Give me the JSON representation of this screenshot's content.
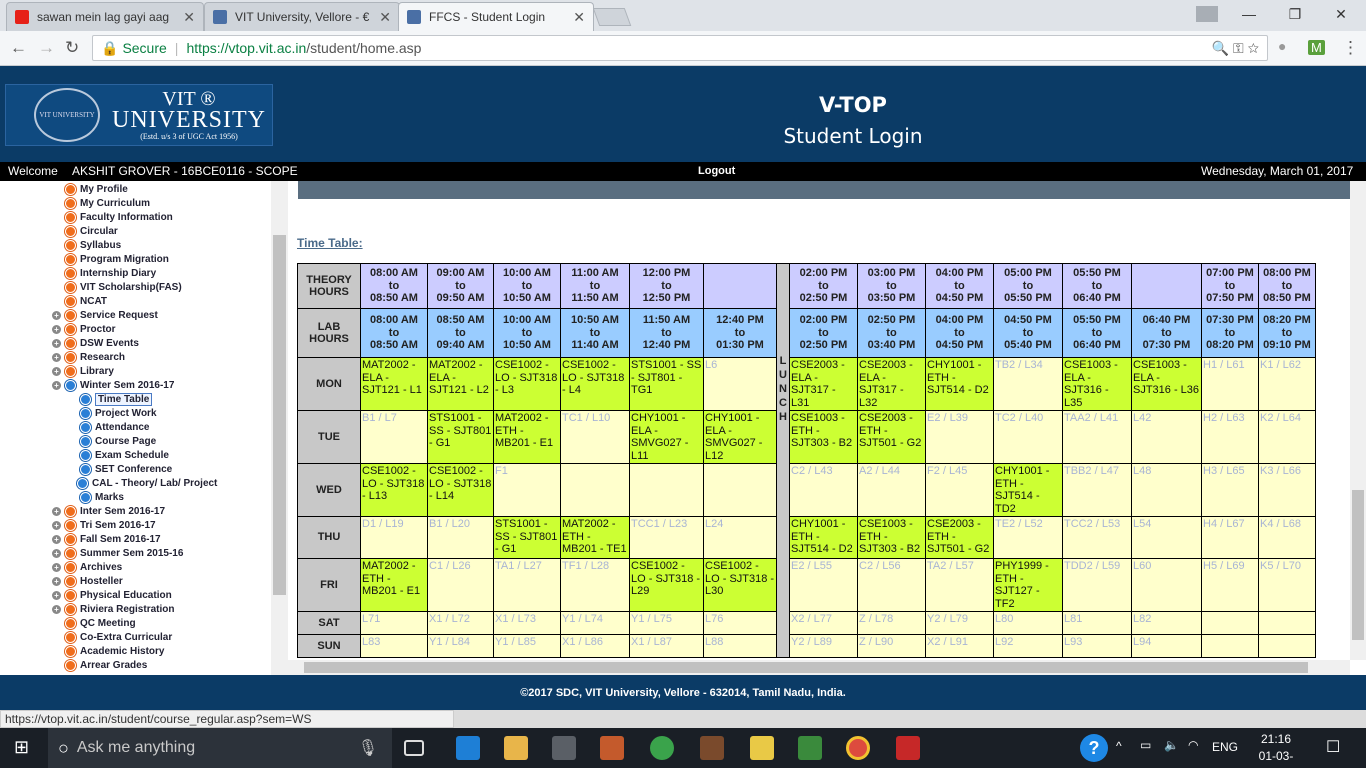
{
  "browser": {
    "tabs": [
      {
        "title": "sawan mein lag gayi aag",
        "icon_color": "#e62117",
        "icon": "youtube-icon"
      },
      {
        "title": "VIT University, Vellore - €",
        "icon_color": "#4a6fa5",
        "icon": "vit-favicon-icon"
      },
      {
        "title": "FFCS - Student Login",
        "icon_color": "#4a6fa5",
        "icon": "vit-favicon-icon"
      }
    ],
    "secure_label": "Secure",
    "url_host": "https://vtop.vit.ac.in",
    "url_path": "/student/home.asp",
    "status_url": "https://vtop.vit.ac.in/student/course_regular.asp?sem=WS"
  },
  "header": {
    "logo_line1": "VIT ®",
    "logo_line2": "UNIVERSITY",
    "logo_line3": "(Estd. u/s 3 of UGC Act 1956)",
    "seal_text": "VIT UNIVERSITY",
    "title1": "V-TOP",
    "title2": "Student Login"
  },
  "welcome": {
    "label": "Welcome",
    "user": "AKSHIT GROVER - 16BCE0116 - SCOPE",
    "logout": "Logout",
    "date": "Wednesday, March 01, 2017"
  },
  "sidebar": {
    "items": [
      {
        "label": "My Profile",
        "type": "or",
        "level": 0
      },
      {
        "label": "My Curriculum",
        "type": "or",
        "level": 0
      },
      {
        "label": "Faculty Information",
        "type": "or",
        "level": 0
      },
      {
        "label": "Circular",
        "type": "or",
        "level": 0
      },
      {
        "label": "Syllabus",
        "type": "or",
        "level": 0
      },
      {
        "label": "Program Migration",
        "type": "or",
        "level": 0
      },
      {
        "label": "Internship Diary",
        "type": "or",
        "level": 0
      },
      {
        "label": "VIT Scholarship(FAS)",
        "type": "or",
        "level": 0
      },
      {
        "label": "NCAT",
        "type": "or",
        "level": 0
      },
      {
        "label": "Service Request",
        "type": "or",
        "level": 0,
        "expand": true
      },
      {
        "label": "Proctor",
        "type": "or",
        "level": 0,
        "expand": true
      },
      {
        "label": "DSW Events",
        "type": "or",
        "level": 0,
        "expand": true
      },
      {
        "label": "Research",
        "type": "or",
        "level": 0,
        "expand": true
      },
      {
        "label": "Library",
        "type": "or",
        "level": 0,
        "expand": true
      },
      {
        "label": "Winter Sem 2016-17",
        "type": "bl",
        "level": 0,
        "expand": true
      },
      {
        "label": "Time Table",
        "type": "bl",
        "level": 1,
        "selected": true
      },
      {
        "label": "Project Work",
        "type": "bl",
        "level": 1
      },
      {
        "label": "Attendance",
        "type": "bl",
        "level": 1
      },
      {
        "label": "Course Page",
        "type": "bl",
        "level": 1
      },
      {
        "label": "Exam Schedule",
        "type": "bl",
        "level": 1
      },
      {
        "label": "SET Conference",
        "type": "bl",
        "level": 1
      },
      {
        "label": "CAL - Theory/ Lab/ Project",
        "type": "bl",
        "level": 2
      },
      {
        "label": "Marks",
        "type": "bl",
        "level": 1
      },
      {
        "label": "Inter Sem 2016-17",
        "type": "or",
        "level": 0,
        "expand": true
      },
      {
        "label": "Tri Sem 2016-17",
        "type": "or",
        "level": 0,
        "expand": true
      },
      {
        "label": "Fall Sem 2016-17",
        "type": "or",
        "level": 0,
        "expand": true
      },
      {
        "label": "Summer Sem 2015-16",
        "type": "or",
        "level": 0,
        "expand": true
      },
      {
        "label": "Archives",
        "type": "or",
        "level": 0,
        "expand": true
      },
      {
        "label": "Hosteller",
        "type": "or",
        "level": 0,
        "expand": true
      },
      {
        "label": "Physical Education",
        "type": "or",
        "level": 0,
        "expand": true
      },
      {
        "label": "Riviera Registration",
        "type": "or",
        "level": 0,
        "expand": true
      },
      {
        "label": "QC Meeting",
        "type": "or",
        "level": 0
      },
      {
        "label": "Co-Extra Curricular",
        "type": "or",
        "level": 0
      },
      {
        "label": "Academic History",
        "type": "or",
        "level": 0
      },
      {
        "label": "Arrear Grades",
        "type": "or",
        "level": 0
      }
    ]
  },
  "timetable": {
    "title": "Time Table:",
    "theory_label": [
      "THEORY",
      "HOURS"
    ],
    "lab_label": [
      "LAB",
      "HOURS"
    ],
    "lunch_letters": [
      "L",
      "U",
      "N",
      "C",
      "H"
    ],
    "theory_hours": [
      "08:00 AM to 08:50 AM",
      "09:00 AM to 09:50 AM",
      "10:00 AM to 10:50 AM",
      "11:00 AM to 11:50 AM",
      "12:00 PM to 12:50 PM",
      "",
      "02:00 PM to 02:50 PM",
      "03:00 PM to 03:50 PM",
      "04:00 PM to 04:50 PM",
      "05:00 PM to 05:50 PM",
      "05:50 PM to 06:40 PM",
      "",
      "07:00 PM to 07:50 PM",
      "08:00 PM to 08:50 PM"
    ],
    "lab_hours": [
      "08:00 AM to 08:50 AM",
      "08:50 AM to 09:40 AM",
      "10:00 AM to 10:50 AM",
      "10:50 AM to 11:40 AM",
      "11:50 AM to 12:40 PM",
      "12:40 PM to 01:30 PM",
      "02:00 PM to 02:50 PM",
      "02:50 PM to 03:40 PM",
      "04:00 PM to 04:50 PM",
      "04:50 PM to 05:40 PM",
      "05:50 PM to 06:40 PM",
      "06:40 PM to 07:30 PM",
      "07:30 PM to 08:20 PM",
      "08:20 PM to 09:10 PM"
    ],
    "days": [
      {
        "name": "MON",
        "cells": [
          [
            "MAT2002 - ELA - SJT121 - L1",
            1
          ],
          [
            "MAT2002 - ELA - SJT121 - L2",
            1
          ],
          [
            "CSE1002 - LO - SJT318 - L3",
            1
          ],
          [
            "CSE1002 - LO - SJT318 - L4",
            1
          ],
          [
            "STS1001 - SS - SJT801 - TG1",
            1
          ],
          [
            "L6",
            0
          ],
          [
            "CSE2003 - ELA - SJT317 - L31",
            1
          ],
          [
            "CSE2003 - ELA - SJT317 - L32",
            1
          ],
          [
            "CHY1001 - ETH - SJT514 - D2",
            1
          ],
          [
            "TB2 / L34",
            0
          ],
          [
            "CSE1003 - ELA - SJT316 - L35",
            1
          ],
          [
            "CSE1003 - ELA - SJT316 - L36",
            1
          ],
          [
            "H1 / L61",
            0
          ],
          [
            "K1 / L62",
            0
          ]
        ]
      },
      {
        "name": "TUE",
        "cells": [
          [
            "B1 / L7",
            0
          ],
          [
            "STS1001 - SS - SJT801 - G1",
            1
          ],
          [
            "MAT2002 - ETH - MB201 - E1",
            1
          ],
          [
            "TC1 / L10",
            0
          ],
          [
            "CHY1001 - ELA - SMVG027 - L11",
            1
          ],
          [
            "CHY1001 - ELA - SMVG027 - L12",
            1
          ],
          [
            "CSE1003 - ETH - SJT303 - B2",
            1
          ],
          [
            "CSE2003 - ETH - SJT501 - G2",
            1
          ],
          [
            "E2 / L39",
            0
          ],
          [
            "TC2 / L40",
            0
          ],
          [
            "TAA2 / L41",
            0
          ],
          [
            "L42",
            0
          ],
          [
            "H2 / L63",
            0
          ],
          [
            "K2 / L64",
            0
          ]
        ]
      },
      {
        "name": "WED",
        "cells": [
          [
            "CSE1002 - LO - SJT318 - L13",
            1
          ],
          [
            "CSE1002 - LO - SJT318 - L14",
            1
          ],
          [
            "F1",
            0
          ],
          [
            "",
            0
          ],
          [
            "",
            0
          ],
          [
            "",
            0
          ],
          [
            "C2 / L43",
            0
          ],
          [
            "A2 / L44",
            0
          ],
          [
            "F2 / L45",
            0
          ],
          [
            "CHY1001 - ETH - SJT514 - TD2",
            1
          ],
          [
            "TBB2 / L47",
            0
          ],
          [
            "L48",
            0
          ],
          [
            "H3 / L65",
            0
          ],
          [
            "K3 / L66",
            0
          ]
        ]
      },
      {
        "name": "THU",
        "cells": [
          [
            "D1 / L19",
            0
          ],
          [
            "B1 / L20",
            0
          ],
          [
            "STS1001 - SS - SJT801 - G1",
            1
          ],
          [
            "MAT2002 - ETH - MB201 - TE1",
            1
          ],
          [
            "TCC1 / L23",
            0
          ],
          [
            "L24",
            0
          ],
          [
            "CHY1001 - ETH - SJT514 - D2",
            1
          ],
          [
            "CSE1003 - ETH - SJT303 - B2",
            1
          ],
          [
            "CSE2003 - ETH - SJT501 - G2",
            1
          ],
          [
            "TE2 / L52",
            0
          ],
          [
            "TCC2 / L53",
            0
          ],
          [
            "L54",
            0
          ],
          [
            "H4 / L67",
            0
          ],
          [
            "K4 / L68",
            0
          ]
        ]
      },
      {
        "name": "FRI",
        "cells": [
          [
            "MAT2002 - ETH - MB201 - E1",
            1
          ],
          [
            "C1 / L26",
            0
          ],
          [
            "TA1 / L27",
            0
          ],
          [
            "TF1 / L28",
            0
          ],
          [
            "CSE1002 - LO - SJT318 - L29",
            1
          ],
          [
            "CSE1002 - LO - SJT318 - L30",
            1
          ],
          [
            "E2 / L55",
            0
          ],
          [
            "C2 / L56",
            0
          ],
          [
            "TA2 / L57",
            0
          ],
          [
            "PHY1999 - ETH - SJT127 - TF2",
            1
          ],
          [
            "TDD2 / L59",
            0
          ],
          [
            "L60",
            0
          ],
          [
            "H5 / L69",
            0
          ],
          [
            "K5 / L70",
            0
          ]
        ]
      },
      {
        "name": "SAT",
        "cells": [
          [
            "L71",
            0
          ],
          [
            "X1 / L72",
            0
          ],
          [
            "X1 / L73",
            0
          ],
          [
            "Y1 / L74",
            0
          ],
          [
            "Y1 / L75",
            0
          ],
          [
            "L76",
            0
          ],
          [
            "X2 / L77",
            0
          ],
          [
            "Z / L78",
            0
          ],
          [
            "Y2 / L79",
            0
          ],
          [
            "L80",
            0
          ],
          [
            "L81",
            0
          ],
          [
            "L82",
            0
          ],
          [
            "",
            0
          ],
          [
            "",
            0
          ]
        ]
      },
      {
        "name": "SUN",
        "cells": [
          [
            "L83",
            0
          ],
          [
            "Y1 / L84",
            0
          ],
          [
            "Y1 / L85",
            0
          ],
          [
            "X1 / L86",
            0
          ],
          [
            "X1 / L87",
            0
          ],
          [
            "L88",
            0
          ],
          [
            "Y2 / L89",
            0
          ],
          [
            "Z / L90",
            0
          ],
          [
            "X2 / L91",
            0
          ],
          [
            "L92",
            0
          ],
          [
            "L93",
            0
          ],
          [
            "L94",
            0
          ],
          [
            "",
            0
          ],
          [
            "",
            0
          ]
        ]
      }
    ]
  },
  "footer": {
    "text": "©2017  SDC, VIT University, Vellore - 632014, Tamil Nadu, India."
  },
  "taskbar": {
    "search_placeholder": "Ask me anything",
    "time": "21:16",
    "date": "01-03-2017",
    "lang": "ENG"
  }
}
